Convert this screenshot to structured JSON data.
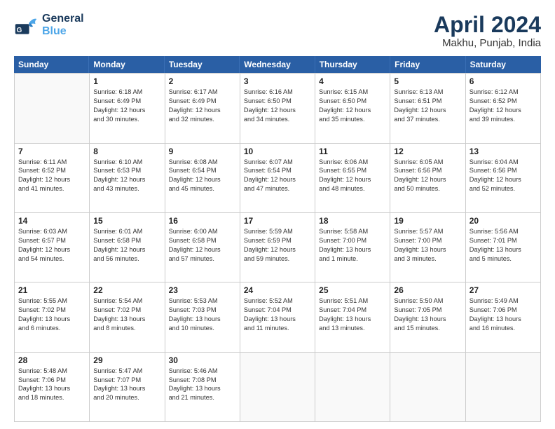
{
  "header": {
    "logo_general": "General",
    "logo_blue": "Blue",
    "month_title": "April 2024",
    "location": "Makhu, Punjab, India"
  },
  "days_of_week": [
    "Sunday",
    "Monday",
    "Tuesday",
    "Wednesday",
    "Thursday",
    "Friday",
    "Saturday"
  ],
  "weeks": [
    [
      {
        "day": "",
        "sunrise": "",
        "sunset": "",
        "daylight": ""
      },
      {
        "day": "1",
        "sunrise": "Sunrise: 6:18 AM",
        "sunset": "Sunset: 6:49 PM",
        "daylight": "Daylight: 12 hours and 30 minutes."
      },
      {
        "day": "2",
        "sunrise": "Sunrise: 6:17 AM",
        "sunset": "Sunset: 6:49 PM",
        "daylight": "Daylight: 12 hours and 32 minutes."
      },
      {
        "day": "3",
        "sunrise": "Sunrise: 6:16 AM",
        "sunset": "Sunset: 6:50 PM",
        "daylight": "Daylight: 12 hours and 34 minutes."
      },
      {
        "day": "4",
        "sunrise": "Sunrise: 6:15 AM",
        "sunset": "Sunset: 6:50 PM",
        "daylight": "Daylight: 12 hours and 35 minutes."
      },
      {
        "day": "5",
        "sunrise": "Sunrise: 6:13 AM",
        "sunset": "Sunset: 6:51 PM",
        "daylight": "Daylight: 12 hours and 37 minutes."
      },
      {
        "day": "6",
        "sunrise": "Sunrise: 6:12 AM",
        "sunset": "Sunset: 6:52 PM",
        "daylight": "Daylight: 12 hours and 39 minutes."
      }
    ],
    [
      {
        "day": "7",
        "sunrise": "Sunrise: 6:11 AM",
        "sunset": "Sunset: 6:52 PM",
        "daylight": "Daylight: 12 hours and 41 minutes."
      },
      {
        "day": "8",
        "sunrise": "Sunrise: 6:10 AM",
        "sunset": "Sunset: 6:53 PM",
        "daylight": "Daylight: 12 hours and 43 minutes."
      },
      {
        "day": "9",
        "sunrise": "Sunrise: 6:08 AM",
        "sunset": "Sunset: 6:54 PM",
        "daylight": "Daylight: 12 hours and 45 minutes."
      },
      {
        "day": "10",
        "sunrise": "Sunrise: 6:07 AM",
        "sunset": "Sunset: 6:54 PM",
        "daylight": "Daylight: 12 hours and 47 minutes."
      },
      {
        "day": "11",
        "sunrise": "Sunrise: 6:06 AM",
        "sunset": "Sunset: 6:55 PM",
        "daylight": "Daylight: 12 hours and 48 minutes."
      },
      {
        "day": "12",
        "sunrise": "Sunrise: 6:05 AM",
        "sunset": "Sunset: 6:56 PM",
        "daylight": "Daylight: 12 hours and 50 minutes."
      },
      {
        "day": "13",
        "sunrise": "Sunrise: 6:04 AM",
        "sunset": "Sunset: 6:56 PM",
        "daylight": "Daylight: 12 hours and 52 minutes."
      }
    ],
    [
      {
        "day": "14",
        "sunrise": "Sunrise: 6:03 AM",
        "sunset": "Sunset: 6:57 PM",
        "daylight": "Daylight: 12 hours and 54 minutes."
      },
      {
        "day": "15",
        "sunrise": "Sunrise: 6:01 AM",
        "sunset": "Sunset: 6:58 PM",
        "daylight": "Daylight: 12 hours and 56 minutes."
      },
      {
        "day": "16",
        "sunrise": "Sunrise: 6:00 AM",
        "sunset": "Sunset: 6:58 PM",
        "daylight": "Daylight: 12 hours and 57 minutes."
      },
      {
        "day": "17",
        "sunrise": "Sunrise: 5:59 AM",
        "sunset": "Sunset: 6:59 PM",
        "daylight": "Daylight: 12 hours and 59 minutes."
      },
      {
        "day": "18",
        "sunrise": "Sunrise: 5:58 AM",
        "sunset": "Sunset: 7:00 PM",
        "daylight": "Daylight: 13 hours and 1 minute."
      },
      {
        "day": "19",
        "sunrise": "Sunrise: 5:57 AM",
        "sunset": "Sunset: 7:00 PM",
        "daylight": "Daylight: 13 hours and 3 minutes."
      },
      {
        "day": "20",
        "sunrise": "Sunrise: 5:56 AM",
        "sunset": "Sunset: 7:01 PM",
        "daylight": "Daylight: 13 hours and 5 minutes."
      }
    ],
    [
      {
        "day": "21",
        "sunrise": "Sunrise: 5:55 AM",
        "sunset": "Sunset: 7:02 PM",
        "daylight": "Daylight: 13 hours and 6 minutes."
      },
      {
        "day": "22",
        "sunrise": "Sunrise: 5:54 AM",
        "sunset": "Sunset: 7:02 PM",
        "daylight": "Daylight: 13 hours and 8 minutes."
      },
      {
        "day": "23",
        "sunrise": "Sunrise: 5:53 AM",
        "sunset": "Sunset: 7:03 PM",
        "daylight": "Daylight: 13 hours and 10 minutes."
      },
      {
        "day": "24",
        "sunrise": "Sunrise: 5:52 AM",
        "sunset": "Sunset: 7:04 PM",
        "daylight": "Daylight: 13 hours and 11 minutes."
      },
      {
        "day": "25",
        "sunrise": "Sunrise: 5:51 AM",
        "sunset": "Sunset: 7:04 PM",
        "daylight": "Daylight: 13 hours and 13 minutes."
      },
      {
        "day": "26",
        "sunrise": "Sunrise: 5:50 AM",
        "sunset": "Sunset: 7:05 PM",
        "daylight": "Daylight: 13 hours and 15 minutes."
      },
      {
        "day": "27",
        "sunrise": "Sunrise: 5:49 AM",
        "sunset": "Sunset: 7:06 PM",
        "daylight": "Daylight: 13 hours and 16 minutes."
      }
    ],
    [
      {
        "day": "28",
        "sunrise": "Sunrise: 5:48 AM",
        "sunset": "Sunset: 7:06 PM",
        "daylight": "Daylight: 13 hours and 18 minutes."
      },
      {
        "day": "29",
        "sunrise": "Sunrise: 5:47 AM",
        "sunset": "Sunset: 7:07 PM",
        "daylight": "Daylight: 13 hours and 20 minutes."
      },
      {
        "day": "30",
        "sunrise": "Sunrise: 5:46 AM",
        "sunset": "Sunset: 7:08 PM",
        "daylight": "Daylight: 13 hours and 21 minutes."
      },
      {
        "day": "",
        "sunrise": "",
        "sunset": "",
        "daylight": ""
      },
      {
        "day": "",
        "sunrise": "",
        "sunset": "",
        "daylight": ""
      },
      {
        "day": "",
        "sunrise": "",
        "sunset": "",
        "daylight": ""
      },
      {
        "day": "",
        "sunrise": "",
        "sunset": "",
        "daylight": ""
      }
    ]
  ]
}
